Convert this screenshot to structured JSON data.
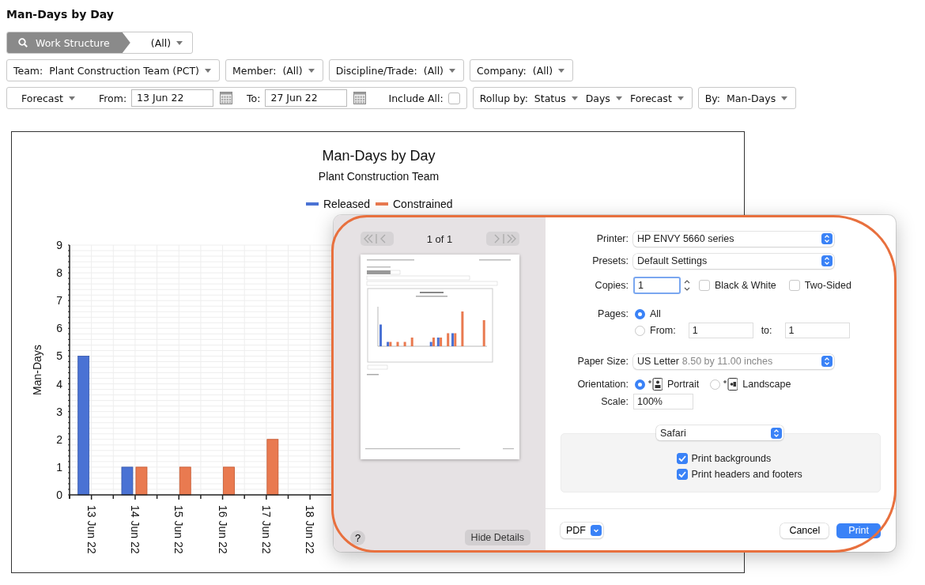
{
  "page_title": "Man-Days by Day",
  "work_structure": {
    "label": "Work Structure",
    "value": "(All)"
  },
  "filter_row": [
    {
      "label": "Team:",
      "value": "Plant Construction Team (PCT)"
    },
    {
      "label": "Member:",
      "value": "(All)"
    },
    {
      "label": "Discipline/Trade:",
      "value": "(All)"
    },
    {
      "label": "Company:",
      "value": "(All)"
    }
  ],
  "date_group": {
    "mode": "Forecast",
    "from_label": "From:",
    "from_value": "13 Jun 22",
    "to_label": "To:",
    "to_value": "27 Jun 22",
    "include_all": {
      "label": "Include All:",
      "checked": false
    }
  },
  "rollup": {
    "label": "Rollup by:",
    "options": [
      "Status",
      "Days",
      "Forecast"
    ]
  },
  "by": {
    "label": "By:",
    "value": "Man-Days"
  },
  "chart": {
    "subtitle": "Plant Construction Team",
    "chart_data": {
      "type": "bar",
      "title": "Man-Days by Day",
      "ylabel": "Man-Days",
      "categories": [
        "13 Jun 22",
        "14 Jun 22",
        "15 Jun 22",
        "16 Jun 22",
        "17 Jun 22",
        "18 Jun 22"
      ],
      "series": [
        {
          "name": "Released",
          "color": "#4a72d4",
          "values": [
            5,
            1,
            0,
            0,
            0,
            0
          ]
        },
        {
          "name": "Constrained",
          "color": "#e97a50",
          "values": [
            0,
            1,
            1,
            1,
            2,
            0
          ]
        }
      ],
      "ylim": [
        0,
        9
      ],
      "yticks": [
        0,
        1,
        2,
        3,
        4,
        5,
        6,
        7,
        8,
        9
      ],
      "grid": true,
      "legend": true
    }
  },
  "print_dialog": {
    "page_nav": "1 of 1",
    "help_label": "?",
    "hide_details_label": "Hide Details",
    "printer": {
      "label": "Printer:",
      "value": "HP ENVY 5660 series"
    },
    "presets": {
      "label": "Presets:",
      "value": "Default Settings"
    },
    "copies": {
      "label": "Copies:",
      "value": "1"
    },
    "copy_options": [
      {
        "label": "Black & White",
        "checked": false
      },
      {
        "label": "Two-Sided",
        "checked": false
      }
    ],
    "pages": {
      "label": "Pages:",
      "options": [
        {
          "label": "All",
          "selected": true
        },
        {
          "label": "From:",
          "selected": false
        }
      ],
      "from_value": "1",
      "to_label": "to:",
      "to_value": "1"
    },
    "paper_size": {
      "label": "Paper Size:",
      "value": "US Letter",
      "detail": "8.50 by 11.00 inches"
    },
    "orientation": {
      "label": "Orientation:",
      "options": [
        {
          "label": "Portrait",
          "selected": true,
          "kind": "portrait"
        },
        {
          "label": "Landscape",
          "selected": false,
          "kind": "landscape"
        }
      ]
    },
    "scale": {
      "label": "Scale:",
      "value": "100%"
    },
    "app_section": {
      "value": "Safari",
      "options": [
        {
          "label": "Print backgrounds",
          "checked": true
        },
        {
          "label": "Print headers and footers",
          "checked": true
        }
      ]
    },
    "pdf_label": "PDF",
    "buttons": [
      {
        "label": "Cancel",
        "kind": "secondary"
      },
      {
        "label": "Print",
        "kind": "primary"
      }
    ]
  }
}
